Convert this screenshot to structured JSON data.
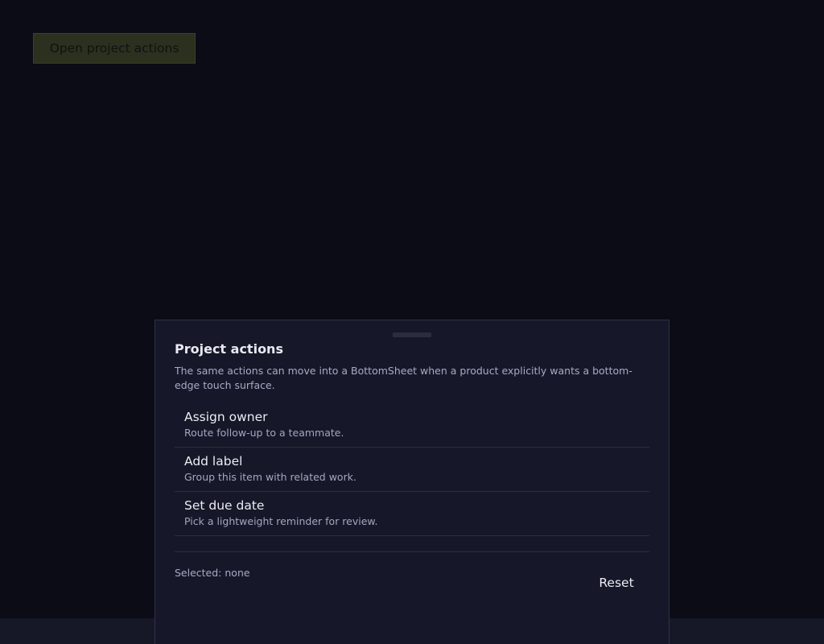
{
  "trigger": {
    "label": "Open project actions"
  },
  "sheet": {
    "title": "Project actions",
    "description": "The same actions can move into a BottomSheet when a product explicitly wants a bottom-edge touch surface.",
    "actions": [
      {
        "title": "Assign owner",
        "subtitle": "Route follow-up to a teammate."
      },
      {
        "title": "Add label",
        "subtitle": "Group this item with related work."
      },
      {
        "title": "Set due date",
        "subtitle": "Pick a lightweight reminder for review."
      }
    ],
    "selected_text": "Selected: none",
    "reset_label": "Reset"
  }
}
